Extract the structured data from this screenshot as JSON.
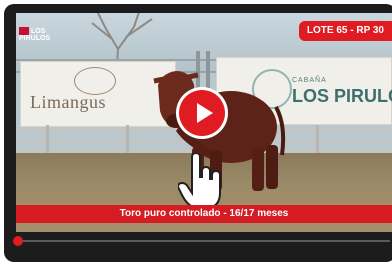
{
  "video": {
    "channel_logo": "LOS PIRULOS",
    "lote_badge": "LOTE 65 - RP 30",
    "banner_left_brand": "Limangus",
    "banner_right_label": "CABAÑA",
    "banner_right_name": "LOS PIRULOS",
    "caption": "Toro puro controlado - 16/17 meses",
    "play_icon": "play-icon",
    "cursor_icon": "hand-pointer-icon"
  },
  "player": {
    "progress_fraction": 0.0,
    "accent_color": "#e11b22"
  }
}
